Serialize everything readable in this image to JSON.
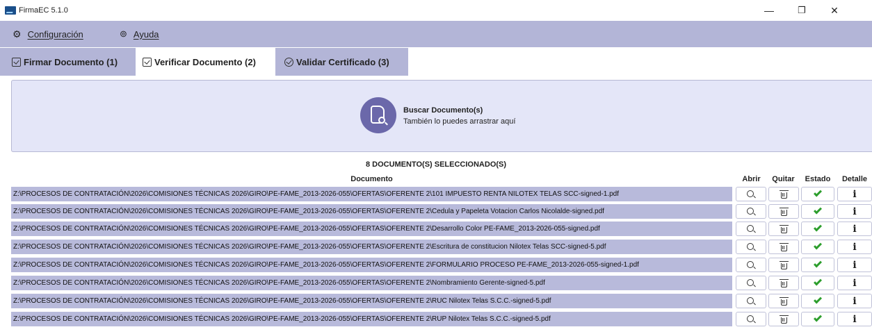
{
  "window": {
    "title": "FirmaEC 5.1.0",
    "controls": [
      "—",
      "❐",
      "✕"
    ]
  },
  "menu": [
    {
      "label": "Configuración",
      "icon": "gear-icon"
    },
    {
      "label": "Ayuda",
      "icon": "help-icon"
    }
  ],
  "tabs": [
    {
      "label": "Firmar Documento (1)",
      "active": false
    },
    {
      "label": "Verificar Documento (2)",
      "active": true
    },
    {
      "label": "Validar Certificado (3)",
      "active": false
    }
  ],
  "drop_zone": {
    "title": "Buscar Documento(s)",
    "subtitle": "También lo puedes arrastrar aquí"
  },
  "table": {
    "summary": "8 DOCUMENTO(S) SELECCIONADO(S)",
    "columns": [
      "Documento",
      "Abrir",
      "Quitar",
      "Estado",
      "Detalle"
    ],
    "rows": [
      {
        "path": "Z:\\PROCESOS DE CONTRATACIÓN\\2026\\COMISIONES TÉCNICAS 2026\\GIRO\\PE-FAME_2013-2026-055\\OFERTAS\\OFERENTE 2\\101 IMPUESTO RENTA NILOTEX TELAS SCC-signed-1.pdf"
      },
      {
        "path": "Z:\\PROCESOS DE CONTRATACIÓN\\2026\\COMISIONES TÉCNICAS 2026\\GIRO\\PE-FAME_2013-2026-055\\OFERTAS\\OFERENTE 2\\Cedula y Papeleta Votacion Carlos Nicolalde-signed.pdf"
      },
      {
        "path": "Z:\\PROCESOS DE CONTRATACIÓN\\2026\\COMISIONES TÉCNICAS 2026\\GIRO\\PE-FAME_2013-2026-055\\OFERTAS\\OFERENTE 2\\Desarrollo Color PE-FAME_2013-2026-055-signed.pdf"
      },
      {
        "path": "Z:\\PROCESOS DE CONTRATACIÓN\\2026\\COMISIONES TÉCNICAS 2026\\GIRO\\PE-FAME_2013-2026-055\\OFERTAS\\OFERENTE 2\\Escritura de constitucion Nilotex Telas SCC-signed-5.pdf"
      },
      {
        "path": "Z:\\PROCESOS DE CONTRATACIÓN\\2026\\COMISIONES TÉCNICAS 2026\\GIRO\\PE-FAME_2013-2026-055\\OFERTAS\\OFERENTE 2\\FORMULARIO PROCESO PE-FAME_2013-2026-055-signed-1.pdf"
      },
      {
        "path": "Z:\\PROCESOS DE CONTRATACIÓN\\2026\\COMISIONES TÉCNICAS 2026\\GIRO\\PE-FAME_2013-2026-055\\OFERTAS\\OFERENTE 2\\Nombramiento Gerente-signed-5.pdf"
      },
      {
        "path": "Z:\\PROCESOS DE CONTRATACIÓN\\2026\\COMISIONES TÉCNICAS 2026\\GIRO\\PE-FAME_2013-2026-055\\OFERTAS\\OFERENTE 2\\RUC Nilotex Telas S.C.C.-signed-5.pdf"
      },
      {
        "path": "Z:\\PROCESOS DE CONTRATACIÓN\\2026\\COMISIONES TÉCNICAS 2026\\GIRO\\PE-FAME_2013-2026-055\\OFERTAS\\OFERENTE 2\\RUP Nilotex Telas S.C.C.-signed-5.pdf"
      }
    ]
  },
  "colors": {
    "bar": "#b3b5d7",
    "drop_zone": "#e4e6f8",
    "accent": "#6b68aa",
    "status_ok": "#2d9e2d"
  }
}
